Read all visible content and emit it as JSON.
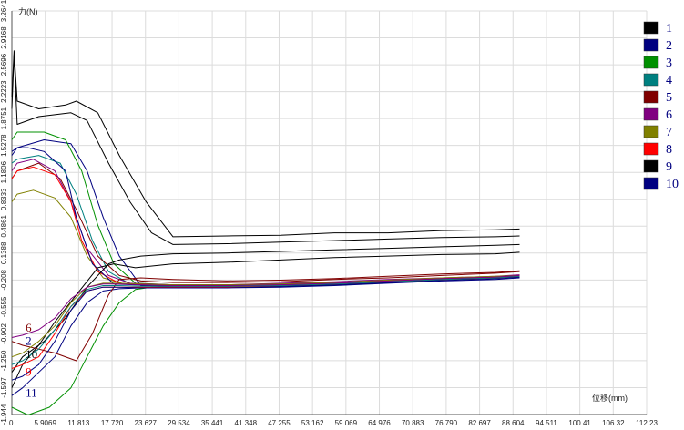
{
  "chart_data": {
    "type": "line",
    "xlabel": "位移(mm)",
    "ylabel": "力(N)",
    "x_ticks": [
      "0",
      "5.9069",
      "11.813",
      "17.720",
      "23.627",
      "29.534",
      "35.441",
      "41.348",
      "47.255",
      "53.162",
      "59.069",
      "64.976",
      "70.883",
      "76.790",
      "82.697",
      "88.604",
      "94.511",
      "100.41",
      "106.32",
      "112.23"
    ],
    "y_ticks": [
      "-1.944",
      "-1.597",
      "-1.250",
      "-0.902",
      "-0.555",
      "-0.208",
      "0.1388",
      "0.4861",
      "0.8333",
      "1.1806",
      "1.5278",
      "1.8751",
      "2.2223",
      "2.5696",
      "2.9168",
      "3.2641"
    ],
    "xlim": [
      0,
      118.14
    ],
    "ylim": [
      -1.944,
      3.2641
    ],
    "grid": true,
    "legend_position": "right",
    "legend": [
      {
        "label": "1",
        "color": "#000000"
      },
      {
        "label": "2",
        "color": "#000080"
      },
      {
        "label": "3",
        "color": "#009000"
      },
      {
        "label": "4",
        "color": "#008080"
      },
      {
        "label": "5",
        "color": "#800000"
      },
      {
        "label": "6",
        "color": "#800080"
      },
      {
        "label": "7",
        "color": "#808000"
      },
      {
        "label": "8",
        "color": "#ff0000"
      },
      {
        "label": "9",
        "color": "#000000"
      },
      {
        "label": "10",
        "color": "#000080"
      }
    ],
    "curve_labels": [
      {
        "text": "6",
        "x": 1.2,
        "y": -0.83,
        "color": "#800000"
      },
      {
        "text": "2",
        "x": 1.2,
        "y": -1.0,
        "color": "#000080"
      },
      {
        "text": "10",
        "x": 1.2,
        "y": -1.17,
        "color": "#000000"
      },
      {
        "text": "9",
        "x": 1.2,
        "y": -1.4,
        "color": "#ff0000"
      },
      {
        "text": "11",
        "x": 1.2,
        "y": -1.67,
        "color": "#000080"
      }
    ],
    "series": [
      {
        "color": "#000000",
        "x": [
          0,
          0.4,
          1,
          5,
          10,
          12,
          16,
          20,
          25,
          30,
          40,
          50,
          60,
          70,
          80,
          90,
          94.5
        ],
        "y": [
          2.15,
          2.75,
          2.1,
          2.0,
          2.05,
          2.1,
          1.95,
          1.4,
          0.8,
          0.35,
          0.36,
          0.37,
          0.4,
          0.4,
          0.43,
          0.44,
          0.45
        ]
      },
      {
        "color": "#000000",
        "x": [
          0,
          0.4,
          1,
          5,
          11,
          14,
          18,
          22,
          26,
          30,
          40,
          50,
          60,
          70,
          80,
          90,
          94.5
        ],
        "y": [
          2.0,
          2.7,
          1.8,
          1.9,
          1.95,
          1.85,
          1.3,
          0.8,
          0.4,
          0.25,
          0.26,
          0.28,
          0.3,
          0.32,
          0.34,
          0.35,
          0.36
        ]
      },
      {
        "color": "#000080",
        "x": [
          0,
          1,
          6,
          11,
          14,
          17,
          20,
          24,
          30,
          40,
          50,
          60,
          70,
          80,
          90,
          94.5
        ],
        "y": [
          1.4,
          1.5,
          1.6,
          1.55,
          1.2,
          0.6,
          0.1,
          -0.28,
          -0.3,
          -0.3,
          -0.29,
          -0.27,
          -0.24,
          -0.2,
          -0.18,
          -0.16
        ]
      },
      {
        "color": "#009000",
        "x": [
          0,
          1,
          6,
          10,
          13,
          16,
          19,
          23,
          30,
          40,
          50,
          60,
          70,
          80,
          90,
          94.5
        ],
        "y": [
          1.6,
          1.7,
          1.7,
          1.6,
          1.2,
          0.5,
          0.0,
          -0.25,
          -0.27,
          -0.27,
          -0.26,
          -0.24,
          -0.22,
          -0.19,
          -0.17,
          -0.15
        ]
      },
      {
        "color": "#008080",
        "x": [
          0,
          1,
          5,
          9,
          12,
          15,
          18,
          22,
          30,
          40,
          50,
          60,
          70,
          80,
          90,
          94.5
        ],
        "y": [
          1.3,
          1.35,
          1.4,
          1.3,
          0.9,
          0.3,
          -0.1,
          -0.26,
          -0.28,
          -0.28,
          -0.26,
          -0.25,
          -0.22,
          -0.2,
          -0.18,
          -0.16
        ]
      },
      {
        "color": "#800000",
        "x": [
          0,
          1,
          5,
          9,
          12,
          16,
          20,
          24,
          30,
          40,
          50,
          60,
          70,
          80,
          90,
          94.5
        ],
        "y": [
          1.1,
          1.2,
          1.3,
          1.1,
          0.7,
          0.1,
          -0.15,
          -0.22,
          -0.24,
          -0.24,
          -0.23,
          -0.2,
          -0.18,
          -0.15,
          -0.12,
          -0.1
        ]
      },
      {
        "color": "#800080",
        "x": [
          0,
          1,
          4,
          8,
          11,
          14,
          18,
          22,
          30,
          40,
          50,
          60,
          70,
          80,
          90,
          94.5
        ],
        "y": [
          1.2,
          1.3,
          1.35,
          1.2,
          0.8,
          0.2,
          -0.15,
          -0.25,
          -0.27,
          -0.27,
          -0.25,
          -0.23,
          -0.2,
          -0.18,
          -0.16,
          -0.14
        ]
      },
      {
        "color": "#808000",
        "x": [
          0,
          1,
          4,
          8,
          11,
          14,
          17,
          21,
          30,
          40,
          50,
          60,
          70,
          80,
          90,
          94.5
        ],
        "y": [
          0.8,
          0.9,
          0.95,
          0.85,
          0.6,
          0.1,
          -0.18,
          -0.26,
          -0.28,
          -0.28,
          -0.27,
          -0.25,
          -0.22,
          -0.2,
          -0.18,
          -0.17
        ]
      },
      {
        "color": "#ff0000",
        "x": [
          0,
          1,
          4,
          8,
          11,
          13,
          16,
          20,
          30,
          40,
          50,
          60,
          70,
          80,
          90,
          94.5
        ],
        "y": [
          1.1,
          1.2,
          1.25,
          1.15,
          0.8,
          0.3,
          -0.1,
          -0.25,
          -0.28,
          -0.28,
          -0.27,
          -0.25,
          -0.22,
          -0.19,
          -0.17,
          -0.15
        ]
      },
      {
        "color": "#000080",
        "x": [
          0,
          1,
          3,
          6,
          10,
          12,
          15,
          19,
          30,
          40,
          50,
          60,
          70,
          80,
          90,
          94.5
        ],
        "y": [
          1.45,
          1.5,
          1.5,
          1.45,
          1.2,
          0.6,
          0.0,
          -0.26,
          -0.29,
          -0.29,
          -0.28,
          -0.26,
          -0.23,
          -0.2,
          -0.18,
          -0.17
        ]
      },
      {
        "color": "#000000",
        "x": [
          0,
          2,
          6,
          10,
          14,
          18,
          20,
          24,
          30,
          40,
          50,
          60,
          70,
          80,
          90,
          94.5
        ],
        "y": [
          -1.4,
          -1.2,
          -1.0,
          -0.7,
          -0.3,
          0.0,
          0.05,
          0.1,
          0.13,
          0.14,
          0.16,
          0.18,
          0.2,
          0.22,
          0.24,
          0.25
        ]
      },
      {
        "color": "#000000",
        "x": [
          0,
          2,
          5,
          8,
          12,
          16,
          19,
          23,
          30,
          40,
          50,
          60,
          70,
          80,
          90,
          94.5
        ],
        "y": [
          -1.6,
          -1.3,
          -1.05,
          -0.75,
          -0.4,
          -0.05,
          0.0,
          -0.05,
          0.0,
          0.02,
          0.05,
          0.08,
          0.1,
          0.12,
          0.13,
          0.15
        ]
      },
      {
        "color": "#009000",
        "x": [
          0,
          3,
          7,
          11,
          14,
          17,
          20,
          23,
          26,
          30,
          40,
          50,
          60,
          70,
          80,
          90,
          94.5
        ],
        "y": [
          -1.85,
          -1.95,
          -1.85,
          -1.6,
          -1.2,
          -0.8,
          -0.5,
          -0.33,
          -0.3,
          -0.31,
          -0.3,
          -0.29,
          -0.27,
          -0.24,
          -0.2,
          -0.18,
          -0.16
        ]
      },
      {
        "color": "#000080",
        "x": [
          0,
          2,
          5,
          8,
          11,
          14,
          17,
          20,
          24,
          30,
          40,
          50,
          60,
          70,
          80,
          90,
          94.5
        ],
        "y": [
          -1.7,
          -1.6,
          -1.4,
          -1.2,
          -0.8,
          -0.5,
          -0.35,
          -0.32,
          -0.31,
          -0.31,
          -0.3,
          -0.29,
          -0.27,
          -0.24,
          -0.21,
          -0.19,
          -0.17
        ]
      },
      {
        "color": "#ff0000",
        "x": [
          0,
          2,
          5,
          8,
          11,
          14,
          17,
          20,
          24,
          30,
          40,
          50,
          60,
          70,
          80,
          90,
          94.5
        ],
        "y": [
          -1.35,
          -1.3,
          -1.2,
          -0.9,
          -0.55,
          -0.35,
          -0.3,
          -0.3,
          -0.3,
          -0.3,
          -0.3,
          -0.28,
          -0.26,
          -0.23,
          -0.2,
          -0.18,
          -0.16
        ]
      },
      {
        "color": "#800000",
        "x": [
          0,
          2,
          5,
          8,
          12,
          15,
          18,
          20,
          24,
          30,
          40,
          50,
          60,
          70,
          80,
          90,
          94.5
        ],
        "y": [
          -1.0,
          -1.05,
          -1.1,
          -1.15,
          -1.25,
          -0.9,
          -0.4,
          -0.2,
          -0.18,
          -0.2,
          -0.22,
          -0.21,
          -0.19,
          -0.16,
          -0.13,
          -0.11,
          -0.09
        ]
      },
      {
        "color": "#808000",
        "x": [
          0,
          2,
          5,
          8,
          11,
          14,
          17,
          20,
          24,
          30,
          40,
          50,
          60,
          70,
          80,
          90,
          94.5
        ],
        "y": [
          -1.2,
          -1.15,
          -1.0,
          -0.8,
          -0.5,
          -0.3,
          -0.25,
          -0.25,
          -0.26,
          -0.27,
          -0.27,
          -0.26,
          -0.24,
          -0.21,
          -0.18,
          -0.16,
          -0.15
        ]
      },
      {
        "color": "#008080",
        "x": [
          0,
          2,
          5,
          8,
          11,
          14,
          17,
          20,
          24,
          30,
          40,
          50,
          60,
          70,
          80,
          90,
          94.5
        ],
        "y": [
          -1.3,
          -1.25,
          -1.1,
          -0.85,
          -0.55,
          -0.33,
          -0.28,
          -0.28,
          -0.29,
          -0.29,
          -0.29,
          -0.28,
          -0.26,
          -0.23,
          -0.2,
          -0.18,
          -0.16
        ]
      },
      {
        "color": "#800080",
        "x": [
          0,
          2,
          5,
          8,
          11,
          14,
          17,
          20,
          24,
          30,
          40,
          50,
          60,
          70,
          80,
          90,
          94.5
        ],
        "y": [
          -0.95,
          -0.92,
          -0.85,
          -0.7,
          -0.45,
          -0.3,
          -0.26,
          -0.26,
          -0.27,
          -0.28,
          -0.28,
          -0.27,
          -0.25,
          -0.22,
          -0.19,
          -0.17,
          -0.15
        ]
      },
      {
        "color": "#000080",
        "x": [
          0,
          2,
          5,
          8,
          11,
          14,
          17,
          20,
          24,
          30,
          40,
          50,
          60,
          70,
          80,
          90,
          94.5
        ],
        "y": [
          -1.5,
          -1.45,
          -1.3,
          -1.0,
          -0.6,
          -0.35,
          -0.3,
          -0.3,
          -0.31,
          -0.31,
          -0.31,
          -0.3,
          -0.28,
          -0.25,
          -0.22,
          -0.2,
          -0.18
        ]
      }
    ]
  }
}
